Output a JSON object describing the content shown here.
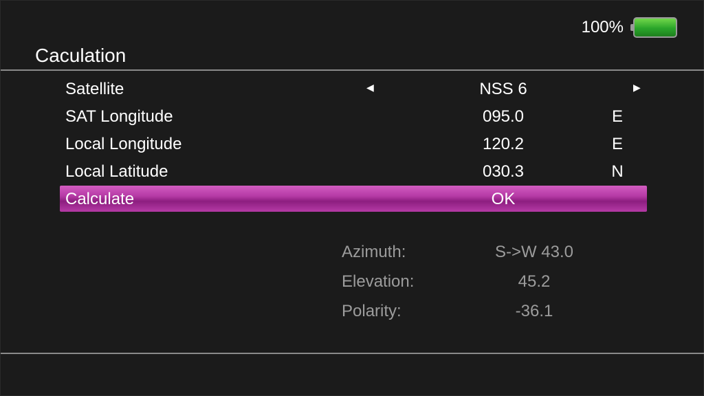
{
  "status": {
    "battery_percent_text": "100%",
    "battery_level": 1.0,
    "battery_color": "#2aa52a"
  },
  "page": {
    "title": "Caculation"
  },
  "menu": {
    "satellite": {
      "label": "Satellite",
      "value": "NSS 6"
    },
    "sat_longitude": {
      "label": "SAT Longitude",
      "value": "095.0",
      "unit": "E"
    },
    "local_longitude": {
      "label": "Local Longitude",
      "value": "120.2",
      "unit": "E"
    },
    "local_latitude": {
      "label": "Local Latitude",
      "value": "030.3",
      "unit": "N"
    },
    "calculate": {
      "label": "Calculate",
      "value": "OK"
    }
  },
  "results": {
    "azimuth": {
      "label": "Azimuth:",
      "value": "S->W 43.0"
    },
    "elevation": {
      "label": "Elevation:",
      "value": "45.2"
    },
    "polarity": {
      "label": "Polarity:",
      "value": "-36.1"
    }
  },
  "icons": {
    "left": "arrow-left-icon",
    "right": "arrow-right-icon",
    "battery": "battery-icon"
  },
  "colors": {
    "selection": "#b63aa6",
    "background": "#1b1b1b",
    "results_text": "#9c9c9c"
  }
}
